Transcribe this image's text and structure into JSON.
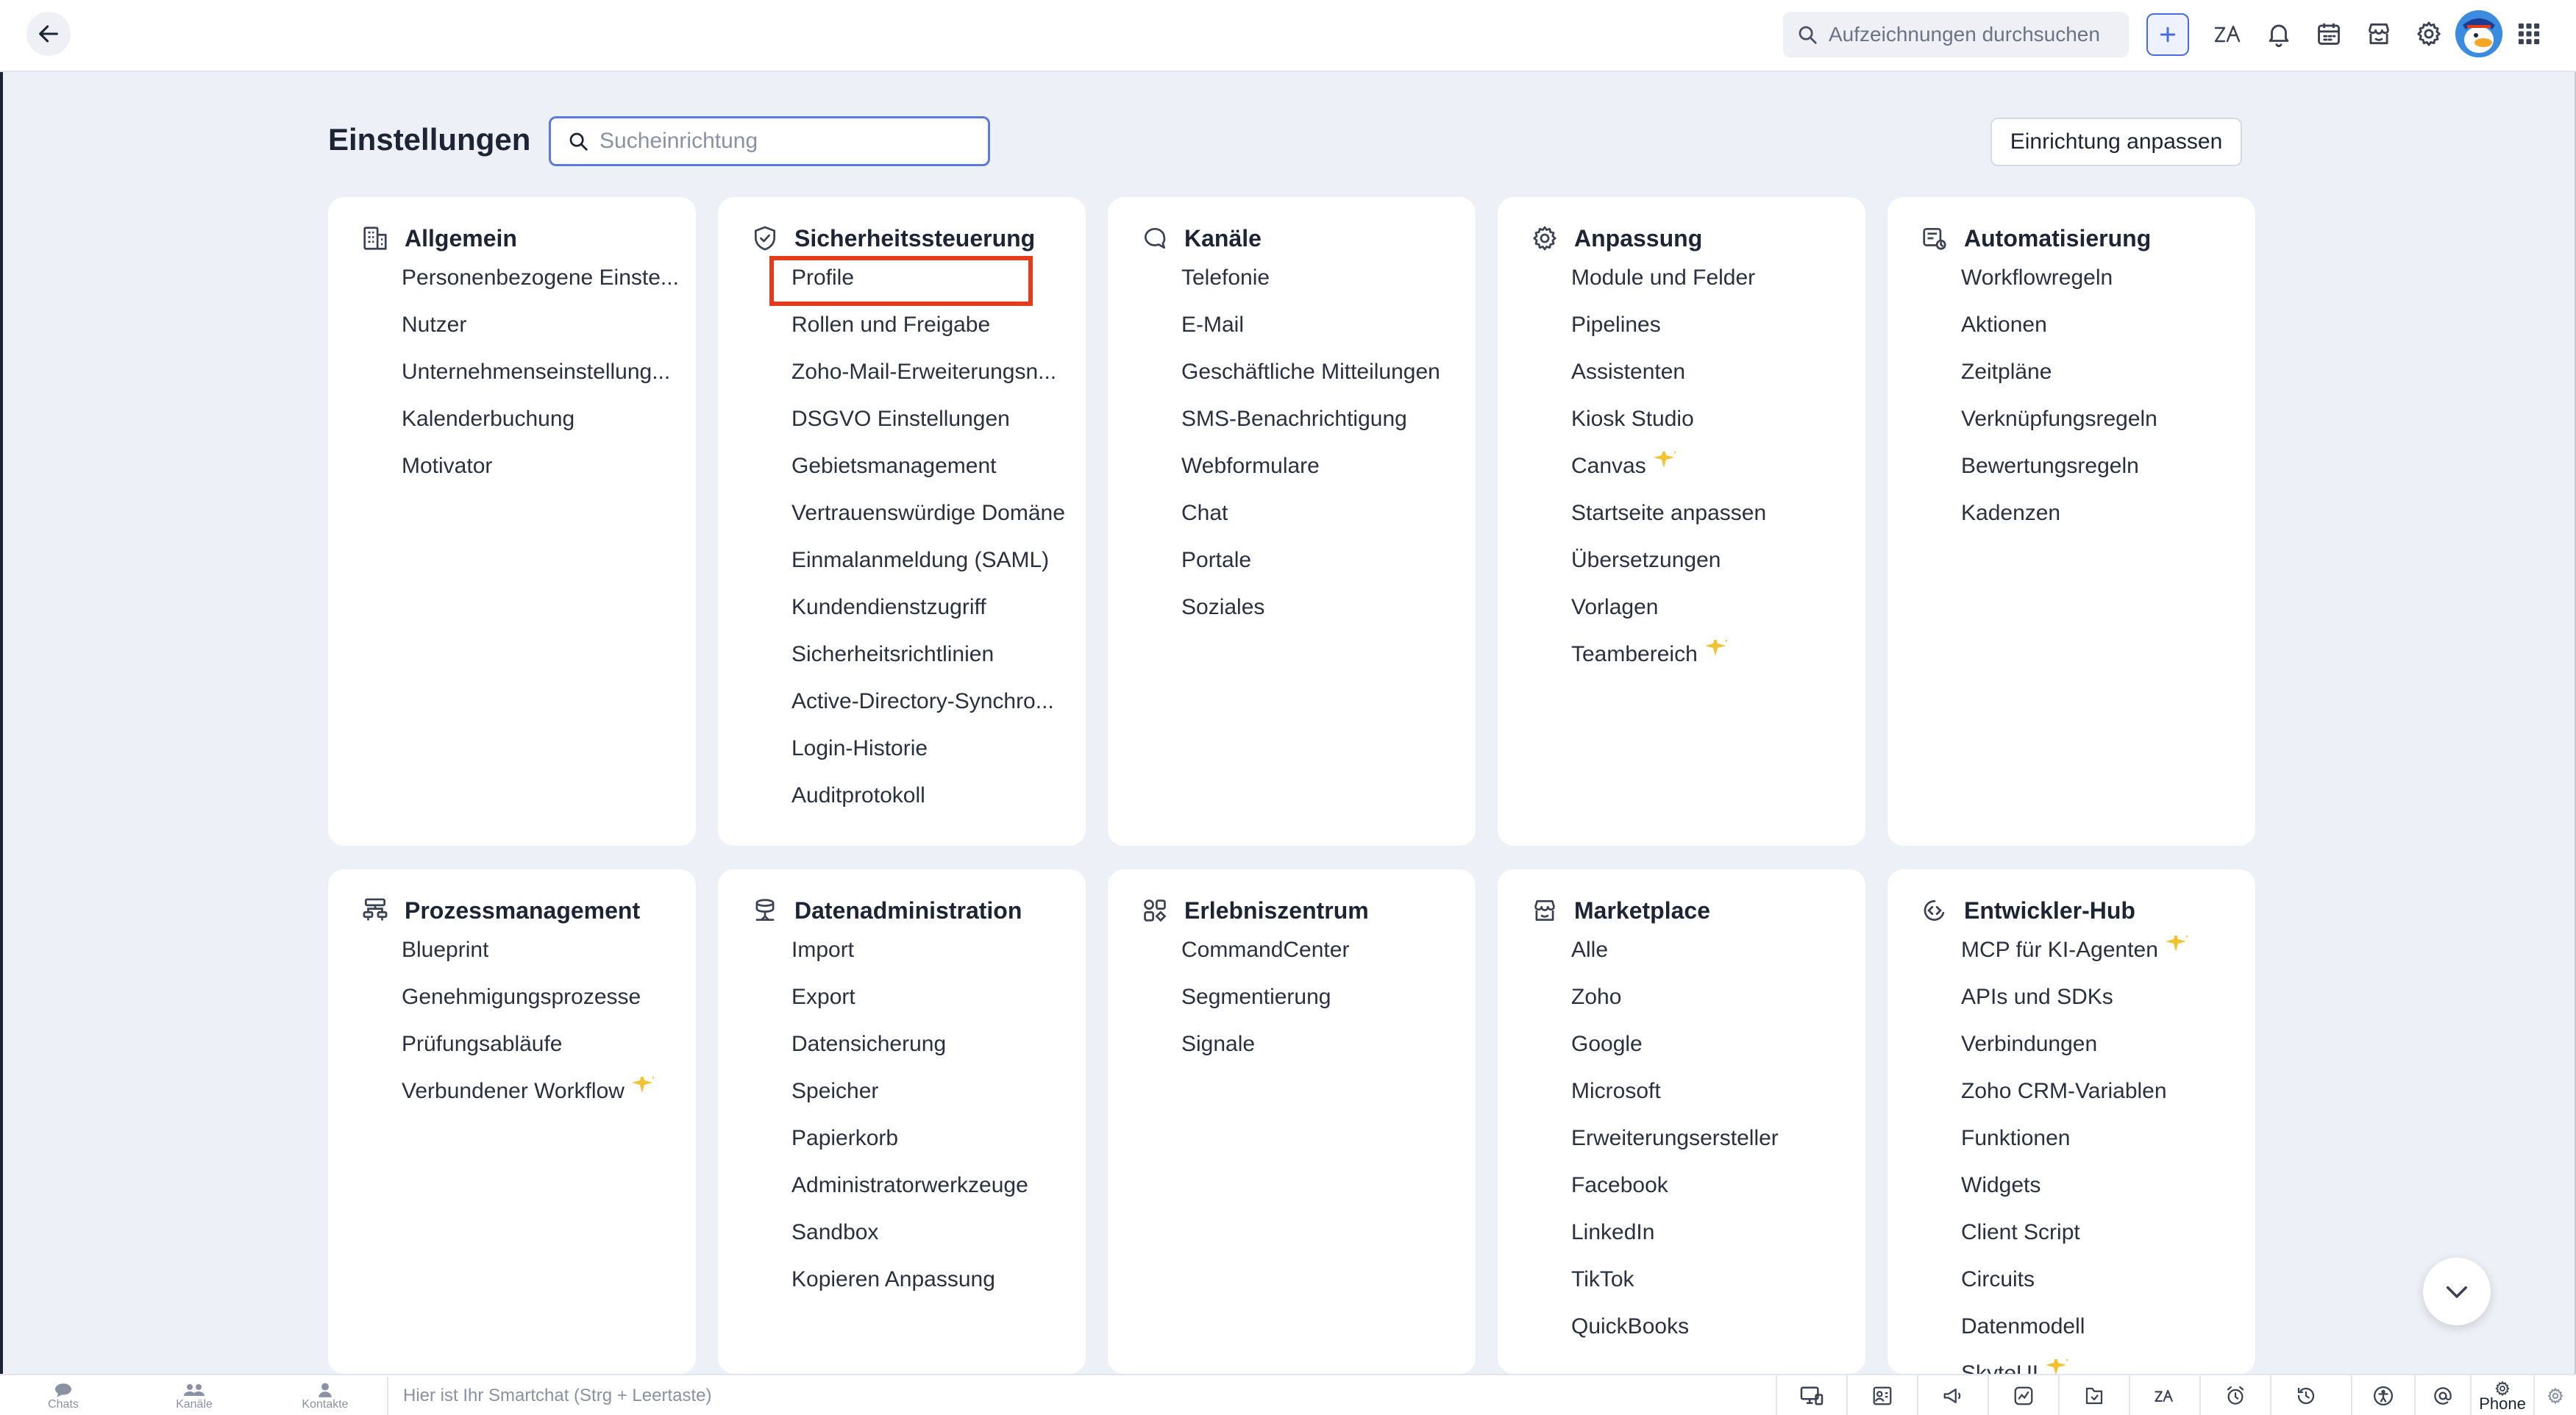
{
  "topbar": {
    "search_placeholder": "Aufzeichnungen durchsuchen"
  },
  "page": {
    "title": "Einstellungen",
    "search_placeholder": "Sucheinrichtung",
    "customize_button": "Einrichtung anpassen"
  },
  "cards": [
    {
      "title": "Allgemein",
      "icon": "building-icon",
      "items": [
        {
          "label": "Personenbezogene Einste..."
        },
        {
          "label": "Nutzer"
        },
        {
          "label": "Unternehmenseinstellung..."
        },
        {
          "label": "Kalenderbuchung"
        },
        {
          "label": "Motivator"
        }
      ]
    },
    {
      "title": "Sicherheitssteuerung",
      "icon": "shield-check-icon",
      "items": [
        {
          "label": "Profile"
        },
        {
          "label": "Rollen und Freigabe"
        },
        {
          "label": "Zoho-Mail-Erweiterungsn..."
        },
        {
          "label": "DSGVO Einstellungen"
        },
        {
          "label": "Gebietsmanagement"
        },
        {
          "label": "Vertrauenswürdige Domäne"
        },
        {
          "label": "Einmalanmeldung (SAML)"
        },
        {
          "label": "Kundendienstzugriff"
        },
        {
          "label": "Sicherheitsrichtlinien"
        },
        {
          "label": "Active-Directory-Synchro..."
        },
        {
          "label": "Login-Historie"
        },
        {
          "label": "Auditprotokoll"
        }
      ]
    },
    {
      "title": "Kanäle",
      "icon": "chat-bubble-icon",
      "items": [
        {
          "label": "Telefonie"
        },
        {
          "label": "E-Mail"
        },
        {
          "label": "Geschäftliche Mitteilungen"
        },
        {
          "label": "SMS-Benachrichtigung"
        },
        {
          "label": "Webformulare"
        },
        {
          "label": "Chat"
        },
        {
          "label": "Portale"
        },
        {
          "label": "Soziales"
        }
      ]
    },
    {
      "title": "Anpassung",
      "icon": "gear-icon",
      "items": [
        {
          "label": "Module und Felder"
        },
        {
          "label": "Pipelines"
        },
        {
          "label": "Assistenten"
        },
        {
          "label": "Kiosk Studio"
        },
        {
          "label": "Canvas",
          "sparkle": true
        },
        {
          "label": "Startseite anpassen"
        },
        {
          "label": "Übersetzungen"
        },
        {
          "label": "Vorlagen"
        },
        {
          "label": "Teambereich",
          "sparkle": true
        }
      ]
    },
    {
      "title": "Automatisierung",
      "icon": "automation-icon",
      "items": [
        {
          "label": "Workflowregeln"
        },
        {
          "label": "Aktionen"
        },
        {
          "label": "Zeitpläne"
        },
        {
          "label": "Verknüpfungsregeln"
        },
        {
          "label": "Bewertungsregeln"
        },
        {
          "label": "Kadenzen"
        }
      ]
    },
    {
      "title": "Prozessmanagement",
      "icon": "process-icon",
      "items": [
        {
          "label": "Blueprint"
        },
        {
          "label": "Genehmigungsprozesse"
        },
        {
          "label": "Prüfungsabläufe"
        },
        {
          "label": "Verbundener Workflow",
          "sparkle": true
        }
      ]
    },
    {
      "title": "Datenadministration",
      "icon": "database-icon",
      "items": [
        {
          "label": "Import"
        },
        {
          "label": "Export"
        },
        {
          "label": "Datensicherung"
        },
        {
          "label": "Speicher"
        },
        {
          "label": "Papierkorb"
        },
        {
          "label": "Administratorwerkzeuge"
        },
        {
          "label": "Sandbox"
        },
        {
          "label": "Kopieren Anpassung"
        }
      ]
    },
    {
      "title": "Erlebniszentrum",
      "icon": "grid-icon",
      "items": [
        {
          "label": "CommandCenter"
        },
        {
          "label": "Segmentierung"
        },
        {
          "label": "Signale"
        }
      ]
    },
    {
      "title": "Marketplace",
      "icon": "store-icon",
      "items": [
        {
          "label": "Alle"
        },
        {
          "label": "Zoho"
        },
        {
          "label": "Google"
        },
        {
          "label": "Microsoft"
        },
        {
          "label": "Erweiterungsersteller"
        },
        {
          "label": "Facebook"
        },
        {
          "label": "LinkedIn"
        },
        {
          "label": "TikTok"
        },
        {
          "label": "QuickBooks"
        }
      ]
    },
    {
      "title": "Entwickler-Hub",
      "icon": "developer-icon",
      "items": [
        {
          "label": "MCP für KI-Agenten",
          "sparkle": true
        },
        {
          "label": "APIs und SDKs"
        },
        {
          "label": "Verbindungen"
        },
        {
          "label": "Zoho CRM-Variablen"
        },
        {
          "label": "Funktionen"
        },
        {
          "label": "Widgets"
        },
        {
          "label": "Client Script"
        },
        {
          "label": "Circuits"
        },
        {
          "label": "Datenmodell"
        },
        {
          "label": "SkyteUI",
          "sparkle": true
        }
      ]
    }
  ],
  "bottombar": {
    "tabs": [
      "Chats",
      "Kanäle",
      "Kontakte"
    ],
    "smartchat_placeholder": "Hier ist Ihr Smartchat (Strg + Leertaste)",
    "phone_label": "Phone"
  },
  "colors": {
    "accent": "#4a6ce0",
    "highlight": "#e23c1c",
    "sparkle": "#f2c230",
    "background": "#eef0f8"
  }
}
